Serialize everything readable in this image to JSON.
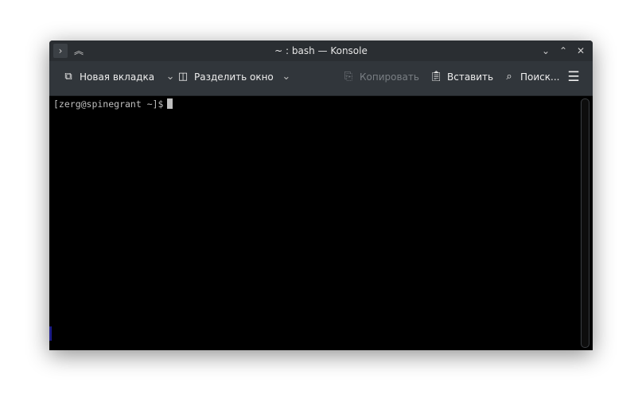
{
  "window": {
    "title": "~ : bash — Konsole"
  },
  "toolbar": {
    "new_tab": "Новая вкладка",
    "split": "Разделить окно",
    "copy": "Копировать",
    "paste": "Вставить",
    "find": "Поиск..."
  },
  "terminal": {
    "prompt": "[zerg@spinegrant ~]$"
  }
}
